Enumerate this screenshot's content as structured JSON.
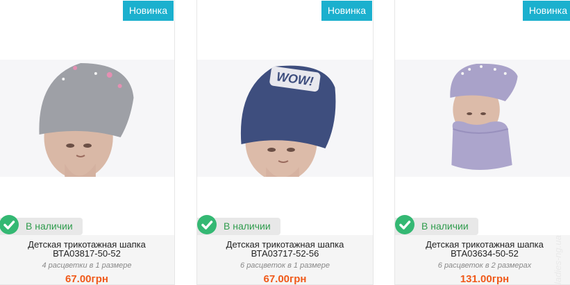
{
  "products": [
    {
      "badge": "Новинка",
      "stock": "В наличии",
      "name_line1": "Детская трикотажная шапка",
      "name_line2": "ВТА03817-50-52",
      "variants": "4 расцветки в 1 размере",
      "price": "67.00грн",
      "hat_color": "#9ea0a6",
      "image_icon": "hat-photo"
    },
    {
      "badge": "Новинка",
      "stock": "В наличии",
      "name_line1": "Детская трикотажная шапка",
      "name_line2": "ВТА03717-52-56",
      "variants": "6 расцветок в 1 размере",
      "price": "67.00грн",
      "hat_color": "#3e4e7e",
      "image_icon": "hat-photo"
    },
    {
      "badge": "Новинка",
      "stock": "В наличии",
      "name_line1": "Детская трикотажная шапка",
      "name_line2": "ВТА03634-50-52",
      "variants": "6 расцветок в 2 размерах",
      "price": "131.00грн",
      "hat_color": "#a9a2c9",
      "image_icon": "hat-photo"
    }
  ],
  "watermark": "ladies-ng.ua",
  "colors": {
    "badge": "#1bb0ce",
    "check": "#34b873",
    "price": "#f05a1a"
  }
}
